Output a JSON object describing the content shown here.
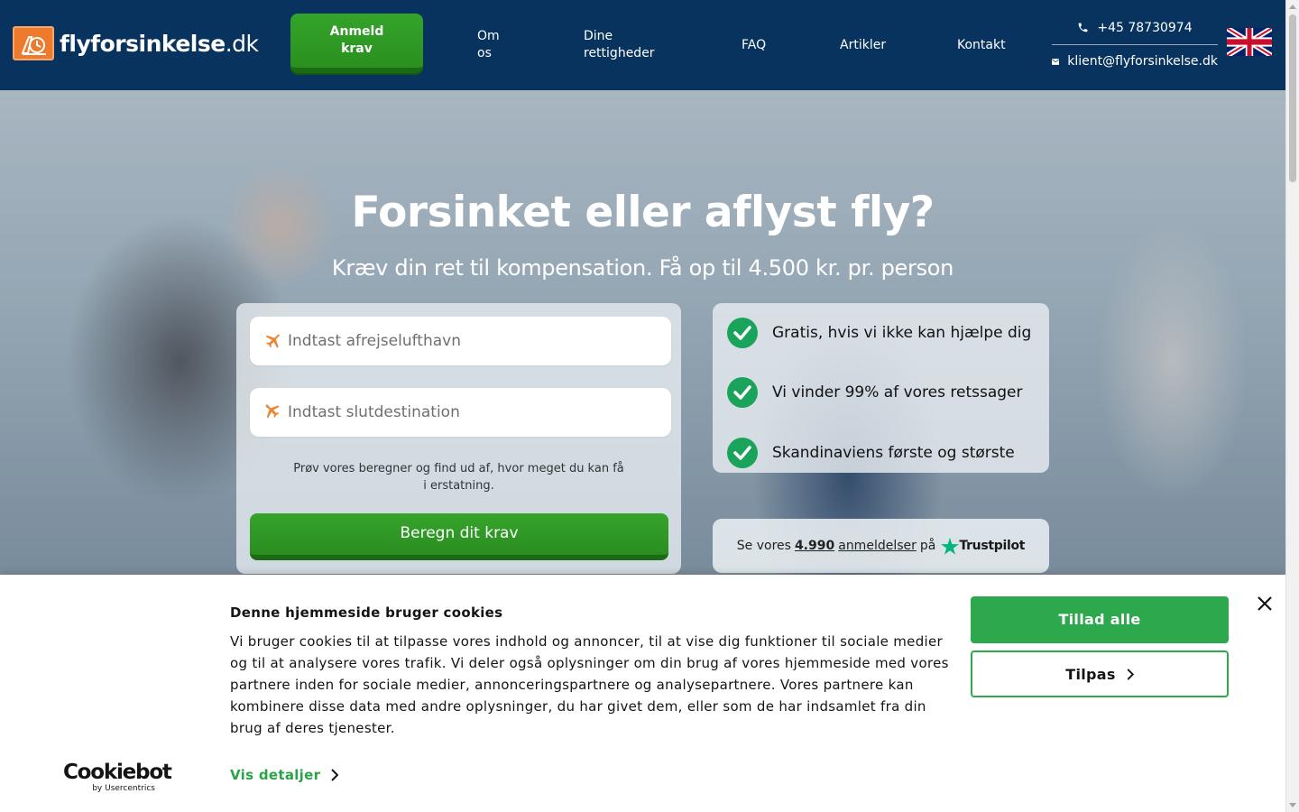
{
  "brand": {
    "logo_text": "flyforsinkelse",
    "logo_tld": ".dk",
    "primary_color": "#07335e",
    "accent_green": "#2ea84c",
    "logo_orange": "#ee7b2d"
  },
  "header": {
    "cta_label_line1": "Anmeld",
    "cta_label_line2": "krav",
    "nav": [
      {
        "line1": "Om",
        "line2": "os"
      },
      {
        "line1": "Dine",
        "line2": "rettigheder"
      },
      {
        "label": "FAQ"
      },
      {
        "label": "Artikler"
      },
      {
        "label": "Kontakt"
      }
    ],
    "phone": "+45 78730974",
    "email": "klient@flyforsinkelse.dk",
    "language_flag": "uk-flag-icon"
  },
  "hero": {
    "title": "Forsinket eller aflyst fly?",
    "subtitle": "Kræv din ret til kompensation. Få op til 4.500 kr. pr. person",
    "form": {
      "departure_placeholder": "Indtast afrejselufthavn",
      "destination_placeholder": "Indtast slutdestination",
      "note": "Prøv vores beregner og find ud af, hvor meget du kan få i erstatning.",
      "submit_label": "Beregn dit krav"
    },
    "usps": [
      "Gratis, hvis vi ikke kan hjælpe dig",
      "Vi vinder 99% af vores retssager",
      "Skandinaviens første og største"
    ],
    "trustpilot": {
      "prefix": "Se vores",
      "count": "4.990",
      "link_text": "anmeldelser",
      "on": "på",
      "brand": "Trustpilot"
    }
  },
  "cookie_banner": {
    "title": "Denne hjemmeside bruger cookies",
    "text": "Vi bruger cookies til at tilpasse vores indhold og annoncer, til at vise dig funktioner til sociale medier og til at analysere vores trafik. Vi deler også oplysninger om din brug af vores hjemmeside med vores partnere inden for sociale medier, annonceringspartnere og analysepartnere. Vores partnere kan kombinere disse data med andre oplysninger, du har givet dem, eller som de har indsamlet fra din brug af deres tjenester.",
    "details_label": "Vis detaljer",
    "allow_all_label": "Tillad alle",
    "customize_label": "Tilpas",
    "provider_name": "Cookiebot",
    "provider_sub": "by Usercentrics"
  }
}
